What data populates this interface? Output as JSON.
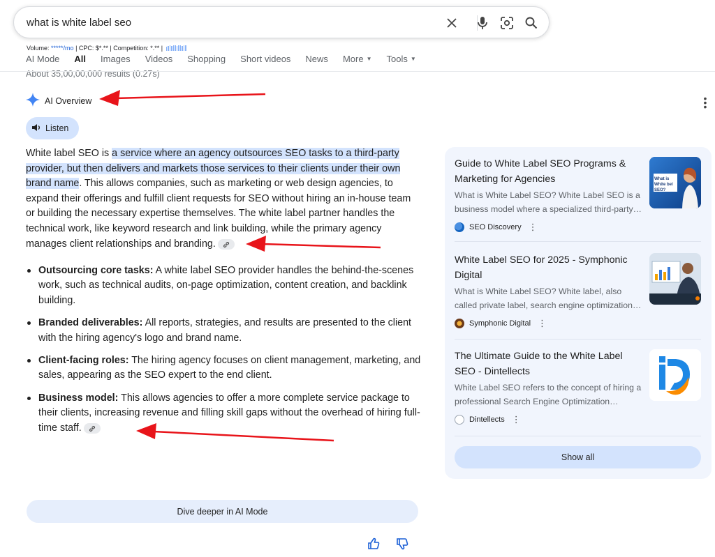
{
  "search": {
    "query": "what is white label seo"
  },
  "metrics": {
    "volume_label": "Volume:",
    "volume_value": "*****/mo",
    "cpc": " | CPC: $*.** | Competition: *.** | "
  },
  "tabs": [
    {
      "label": "AI Mode",
      "active": false
    },
    {
      "label": "All",
      "active": true
    },
    {
      "label": "Images",
      "active": false
    },
    {
      "label": "Videos",
      "active": false
    },
    {
      "label": "Shopping",
      "active": false
    },
    {
      "label": "Short videos",
      "active": false
    },
    {
      "label": "News",
      "active": false
    },
    {
      "label": "More",
      "active": false
    },
    {
      "label": "Tools",
      "active": false
    }
  ],
  "result_stats": "About 35,00,00,000 results (0.27s)",
  "ai_overview": {
    "heading": "AI Overview",
    "listen_label": "Listen",
    "intro_prefix": "White label SEO is ",
    "intro_highlight": "a service where an agency outsources SEO tasks to a third-party provider, but then delivers and markets those services to their clients under their own brand name",
    "intro_rest": ". This allows companies, such as marketing or web design agencies, to expand their offerings and fulfill client requests for SEO without hiring an in-house team or building the necessary expertise themselves. The white label partner handles the technical work, like keyword research and link building, while the primary agency manages client relationships and branding.",
    "bullets": [
      {
        "term": "Outsourcing core tasks:",
        "text": " A white label SEO provider handles the behind-the-scenes work, such as technical audits, on-page optimization, content creation, and backlink building."
      },
      {
        "term": "Branded deliverables:",
        "text": " All reports, strategies, and results are presented to the client with the hiring agency's logo and brand name."
      },
      {
        "term": "Client-facing roles:",
        "text": " The hiring agency focuses on client management, marketing, and sales, appearing as the SEO expert to the end client."
      },
      {
        "term": "Business model:",
        "text": " This allows agencies to offer a more complete service package to their clients, increasing revenue and filling skill gaps without the overhead of hiring full-time staff."
      }
    ],
    "dive_deeper_label": "Dive deeper in AI Mode"
  },
  "sources": [
    {
      "title": "Guide to White Label SEO Programs & Marketing for Agencies",
      "snippet": "What is White Label SEO? White Label SEO is a business model where a specialized third-party…",
      "source": "SEO Discovery",
      "image_text": "What is White bel SEO?"
    },
    {
      "title": "White Label SEO for 2025 - Symphonic Digital",
      "snippet": "What is White Label SEO?  White label, also called private label, search engine optimization…",
      "source": "Symphonic Digital"
    },
    {
      "title": "The Ultimate Guide to the White Label SEO - Dintellects",
      "snippet": "White Label SEO refers to the concept of hiring a professional Search Engine Optimization…",
      "source": "Dintellects"
    }
  ],
  "show_all_label": "Show all",
  "colors": {
    "highlight": "#d3e3fd",
    "panel": "#f1f5fd",
    "annotation_arrow": "#e8141a",
    "link_blue": "#1a5fd6"
  }
}
